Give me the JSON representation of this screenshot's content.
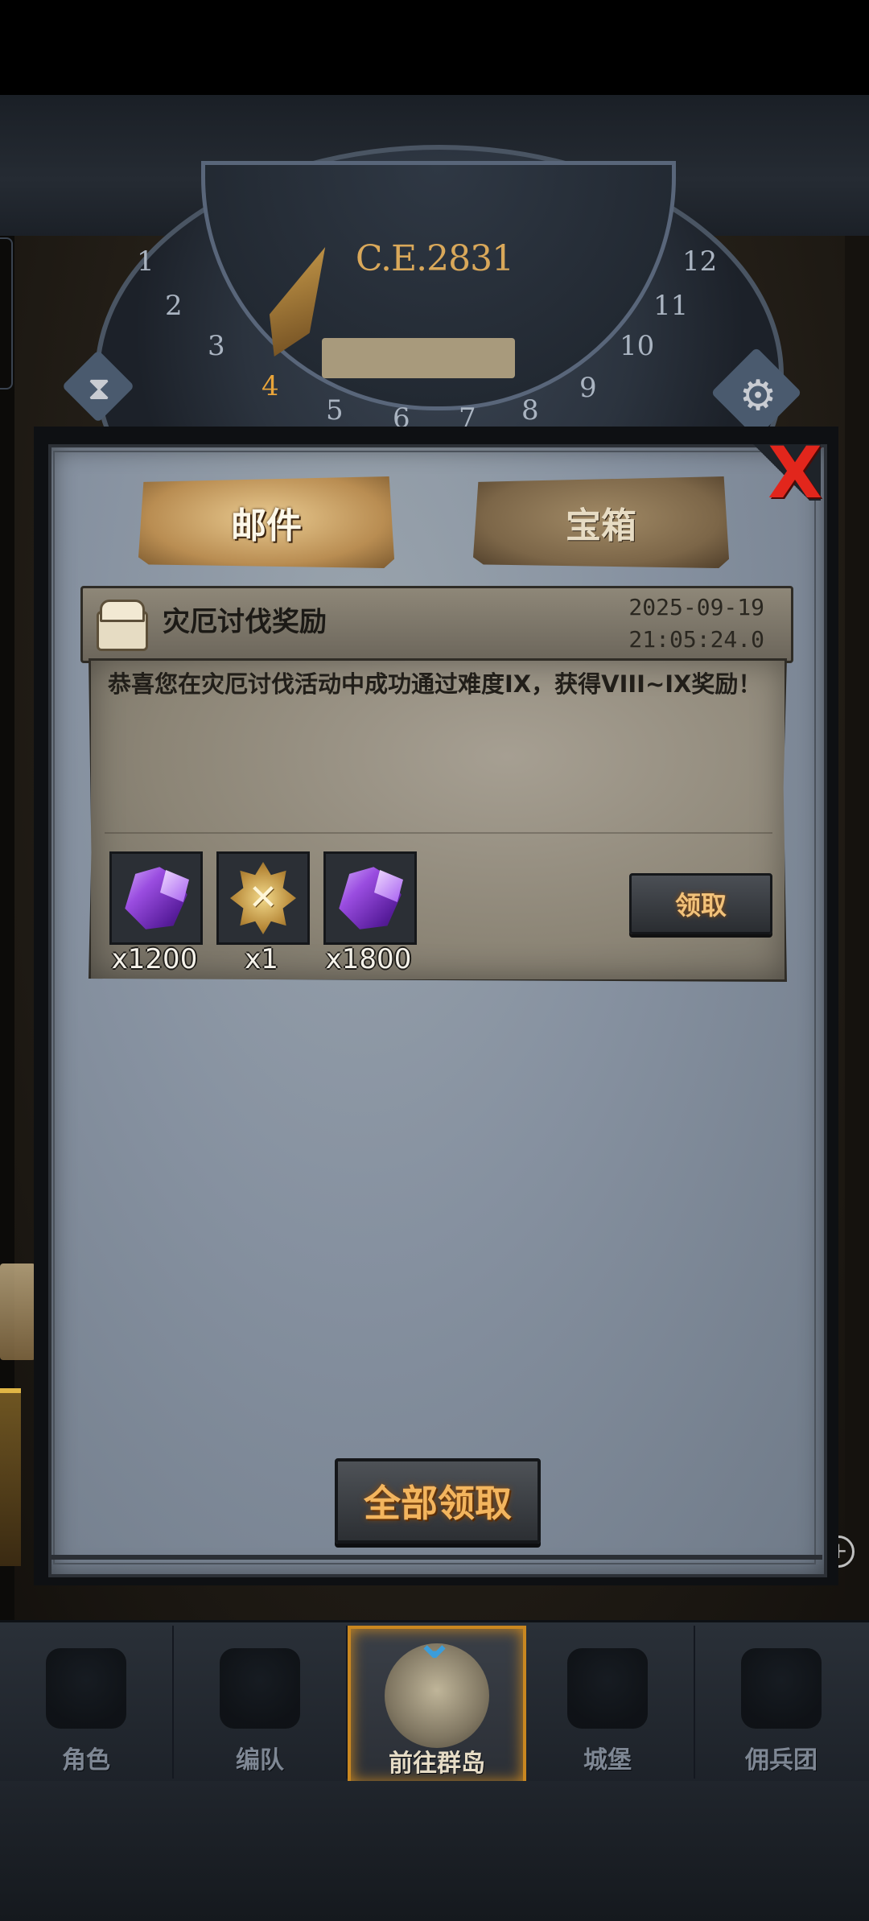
{
  "dial": {
    "year": "C.E.2831",
    "numbers": [
      "1",
      "2",
      "3",
      "4",
      "5",
      "6",
      "7",
      "8",
      "9",
      "10",
      "11",
      "12"
    ],
    "active_number": "4"
  },
  "tabs": {
    "mail": "邮件",
    "chest": "宝箱"
  },
  "close_label": "X",
  "mail": {
    "title": "灾厄讨伐奖励",
    "date": "2025-09-19",
    "time": "21:05:24.0",
    "body": "恭喜您在灾厄讨伐活动中成功通过难度IX，获得VIII~IX奖励！",
    "items": [
      {
        "icon": "purple-crystal-icon",
        "quantity": "x1200"
      },
      {
        "icon": "gold-medal-icon",
        "quantity": "x1"
      },
      {
        "icon": "purple-crystal-icon",
        "quantity": "x1800"
      }
    ],
    "claim_label": "领取"
  },
  "claim_all_label": "全部领取",
  "nav": [
    {
      "label": "角色",
      "icon": "knight-icon"
    },
    {
      "label": "编队",
      "icon": "helmet-icon"
    },
    {
      "label": "前往群岛",
      "icon": "globe-icon",
      "active": true
    },
    {
      "label": "城堡",
      "icon": "castle-icon"
    },
    {
      "label": "佣兵团",
      "icon": "mercenary-icon"
    }
  ],
  "colors": {
    "accent_gold": "#c98720",
    "close_red": "#e2261c",
    "claim_text": "#f3b55e",
    "crystal_purple": "#9a4de0"
  }
}
